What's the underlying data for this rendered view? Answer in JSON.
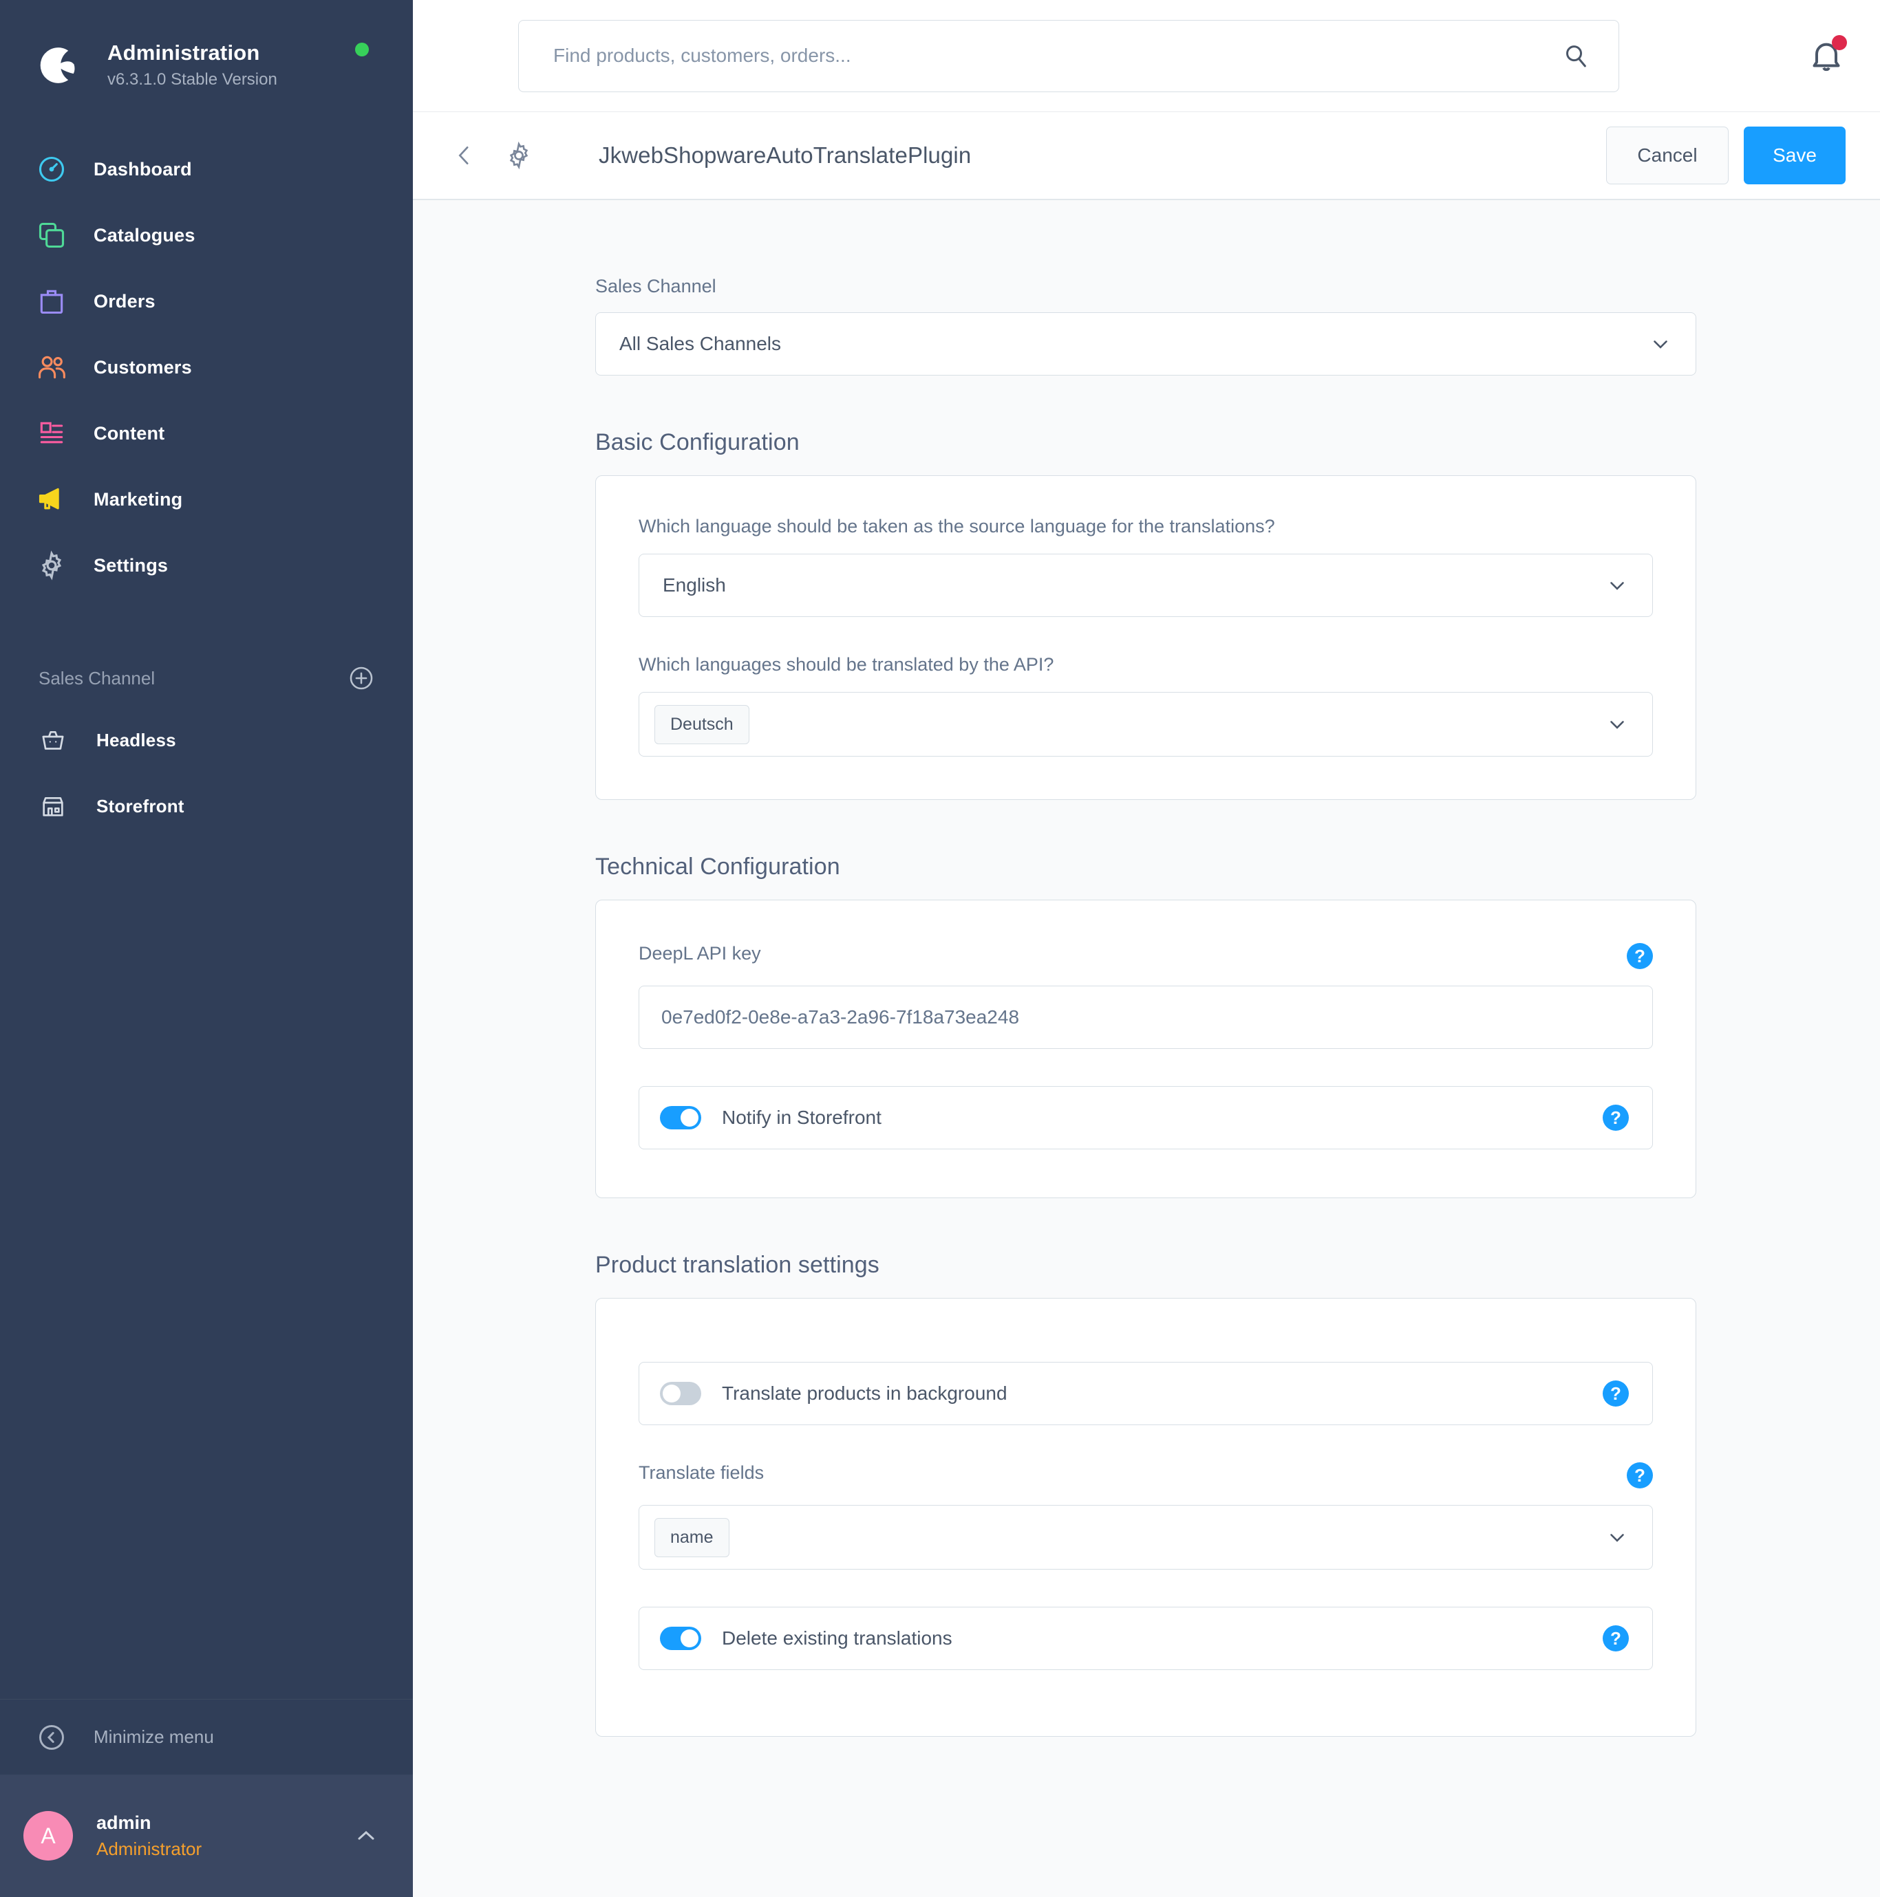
{
  "sidebar": {
    "brand": {
      "title": "Administration",
      "version": "v6.3.1.0 Stable Version"
    },
    "nav": [
      {
        "label": "Dashboard",
        "icon": "gauge-icon"
      },
      {
        "label": "Catalogues",
        "icon": "catalogues-icon"
      },
      {
        "label": "Orders",
        "icon": "bag-icon"
      },
      {
        "label": "Customers",
        "icon": "people-icon"
      },
      {
        "label": "Content",
        "icon": "content-icon"
      },
      {
        "label": "Marketing",
        "icon": "megaphone-icon"
      },
      {
        "label": "Settings",
        "icon": "gear-icon"
      }
    ],
    "section": {
      "title": "Sales Channel",
      "add_icon": "plus-circle-icon"
    },
    "channels": [
      {
        "label": "Headless",
        "icon": "basket-icon"
      },
      {
        "label": "Storefront",
        "icon": "shop-icon"
      }
    ],
    "minimize": {
      "label": "Minimize menu",
      "icon": "chevron-left-circle-icon"
    },
    "user": {
      "initial": "A",
      "name": "admin",
      "role": "Administrator",
      "chevron_icon": "chevron-up-icon"
    }
  },
  "topbar": {
    "search": {
      "placeholder": "Find products, customers, orders...",
      "value": "",
      "icon": "search-icon"
    },
    "notifications": {
      "icon": "bell-icon",
      "has_badge": true
    }
  },
  "pageheader": {
    "back_icon": "chevron-left-icon",
    "gear_icon": "gear-icon",
    "title": "JkwebShopwareAutoTranslatePlugin",
    "cancel_label": "Cancel",
    "save_label": "Save"
  },
  "content": {
    "sales_channel": {
      "label": "Sales Channel",
      "value": "All Sales Channels"
    },
    "basic": {
      "title": "Basic Configuration",
      "source_language": {
        "label": "Which language should be taken as the source language for the translations?",
        "value": "English"
      },
      "api_languages": {
        "label": "Which languages should be translated by the API?",
        "chips": [
          "Deutsch"
        ]
      }
    },
    "technical": {
      "title": "Technical Configuration",
      "api_key": {
        "label": "DeepL API key",
        "value": "0e7ed0f2-0e8e-a7a3-2a96-7f18a73ea248",
        "help": "?"
      },
      "notify": {
        "label": "Notify in Storefront",
        "state": "on",
        "help": "?"
      }
    },
    "product": {
      "title": "Product translation settings",
      "background": {
        "label": "Translate products in background",
        "state": "off",
        "help": "?"
      },
      "fields": {
        "label": "Translate fields",
        "chips": [
          "name"
        ],
        "help": "?"
      },
      "delete_existing": {
        "label": "Delete existing translations",
        "state": "on",
        "help": "?"
      }
    }
  },
  "colors": {
    "sidebar_bg": "#303e58",
    "accent_blue": "#189eff",
    "status_green": "#37d05a",
    "badge_red": "#de294c",
    "avatar_pink": "#f88bb5",
    "role_orange": "#f6a02c"
  }
}
